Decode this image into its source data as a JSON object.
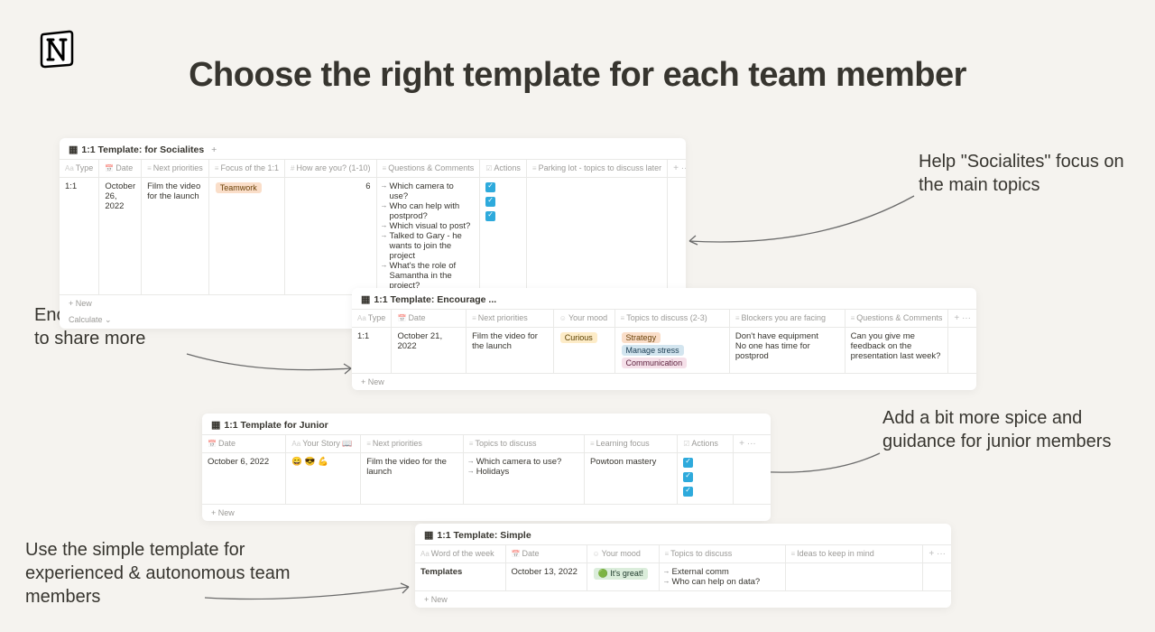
{
  "page": {
    "title": "Choose the right template for each team member"
  },
  "annotations": {
    "socialites": "Help \"Socialites\" focus on the main topics",
    "reserved": "Encourage reserved employees to share more",
    "junior": "Add a bit more spice and guidance for junior members",
    "simple": "Use the simple template for experienced & autonomous team members"
  },
  "cards": {
    "socialites": {
      "title": "1:1 Template: for Socialites",
      "columns": [
        "Type",
        "Date",
        "Next priorities",
        "Focus of the 1:1",
        "How are you? (1-10)",
        "Questions & Comments",
        "Actions",
        "Parking lot - topics to discuss later"
      ],
      "row": {
        "type": "1:1",
        "date": "October 26, 2022",
        "priorities": "Film the video for the launch",
        "focus_tag": "Teamwork",
        "score": "6",
        "questions": [
          "Which camera to use?",
          "Who can help with postprod?",
          "Which visual to post?",
          "Talked to Gary - he wants to join the project",
          "What's the role of Samantha in the project?"
        ]
      },
      "new_label": "+ New",
      "calc_label": "Calculate ⌄"
    },
    "encourage": {
      "title": "1:1 Template: Encourage ...",
      "columns": [
        "Type",
        "Date",
        "Next priorities",
        "Your mood",
        "Topics to discuss (2-3)",
        "Blockers you are facing",
        "Questions & Comments"
      ],
      "row": {
        "type": "1:1",
        "date": "October 21, 2022",
        "priorities": "Film the video for the launch",
        "mood_tag": "Curious",
        "topics_tags": [
          "Strategy",
          "Manage stress",
          "Communication"
        ],
        "blockers": "Don't have equipment\nNo one has time for postprod",
        "feedback": "Can you give me feedback on the presentation last week?"
      },
      "new_label": "+ New"
    },
    "junior": {
      "title": "1:1 Template for Junior",
      "columns": [
        "Date",
        "Your Story 📖",
        "Next priorities",
        "Topics to discuss",
        "Learning focus",
        "Actions"
      ],
      "row": {
        "date": "October 6, 2022",
        "story": "😄 😎 💪",
        "priorities": "Film the video for the launch",
        "topics": [
          "Which camera to use?",
          "Holidays"
        ],
        "learning": "Powtoon mastery"
      },
      "new_label": "+ New"
    },
    "simple": {
      "title": "1:1 Template: Simple",
      "columns": [
        "Word of the week",
        "Date",
        "Your mood",
        "Topics to discuss",
        "Ideas to keep in mind"
      ],
      "row": {
        "word": "Templates",
        "date": "October 13, 2022",
        "mood": "🟢 It's great!",
        "topics": [
          "External comm",
          "Who can help on data?"
        ]
      },
      "new_label": "+ New"
    }
  }
}
